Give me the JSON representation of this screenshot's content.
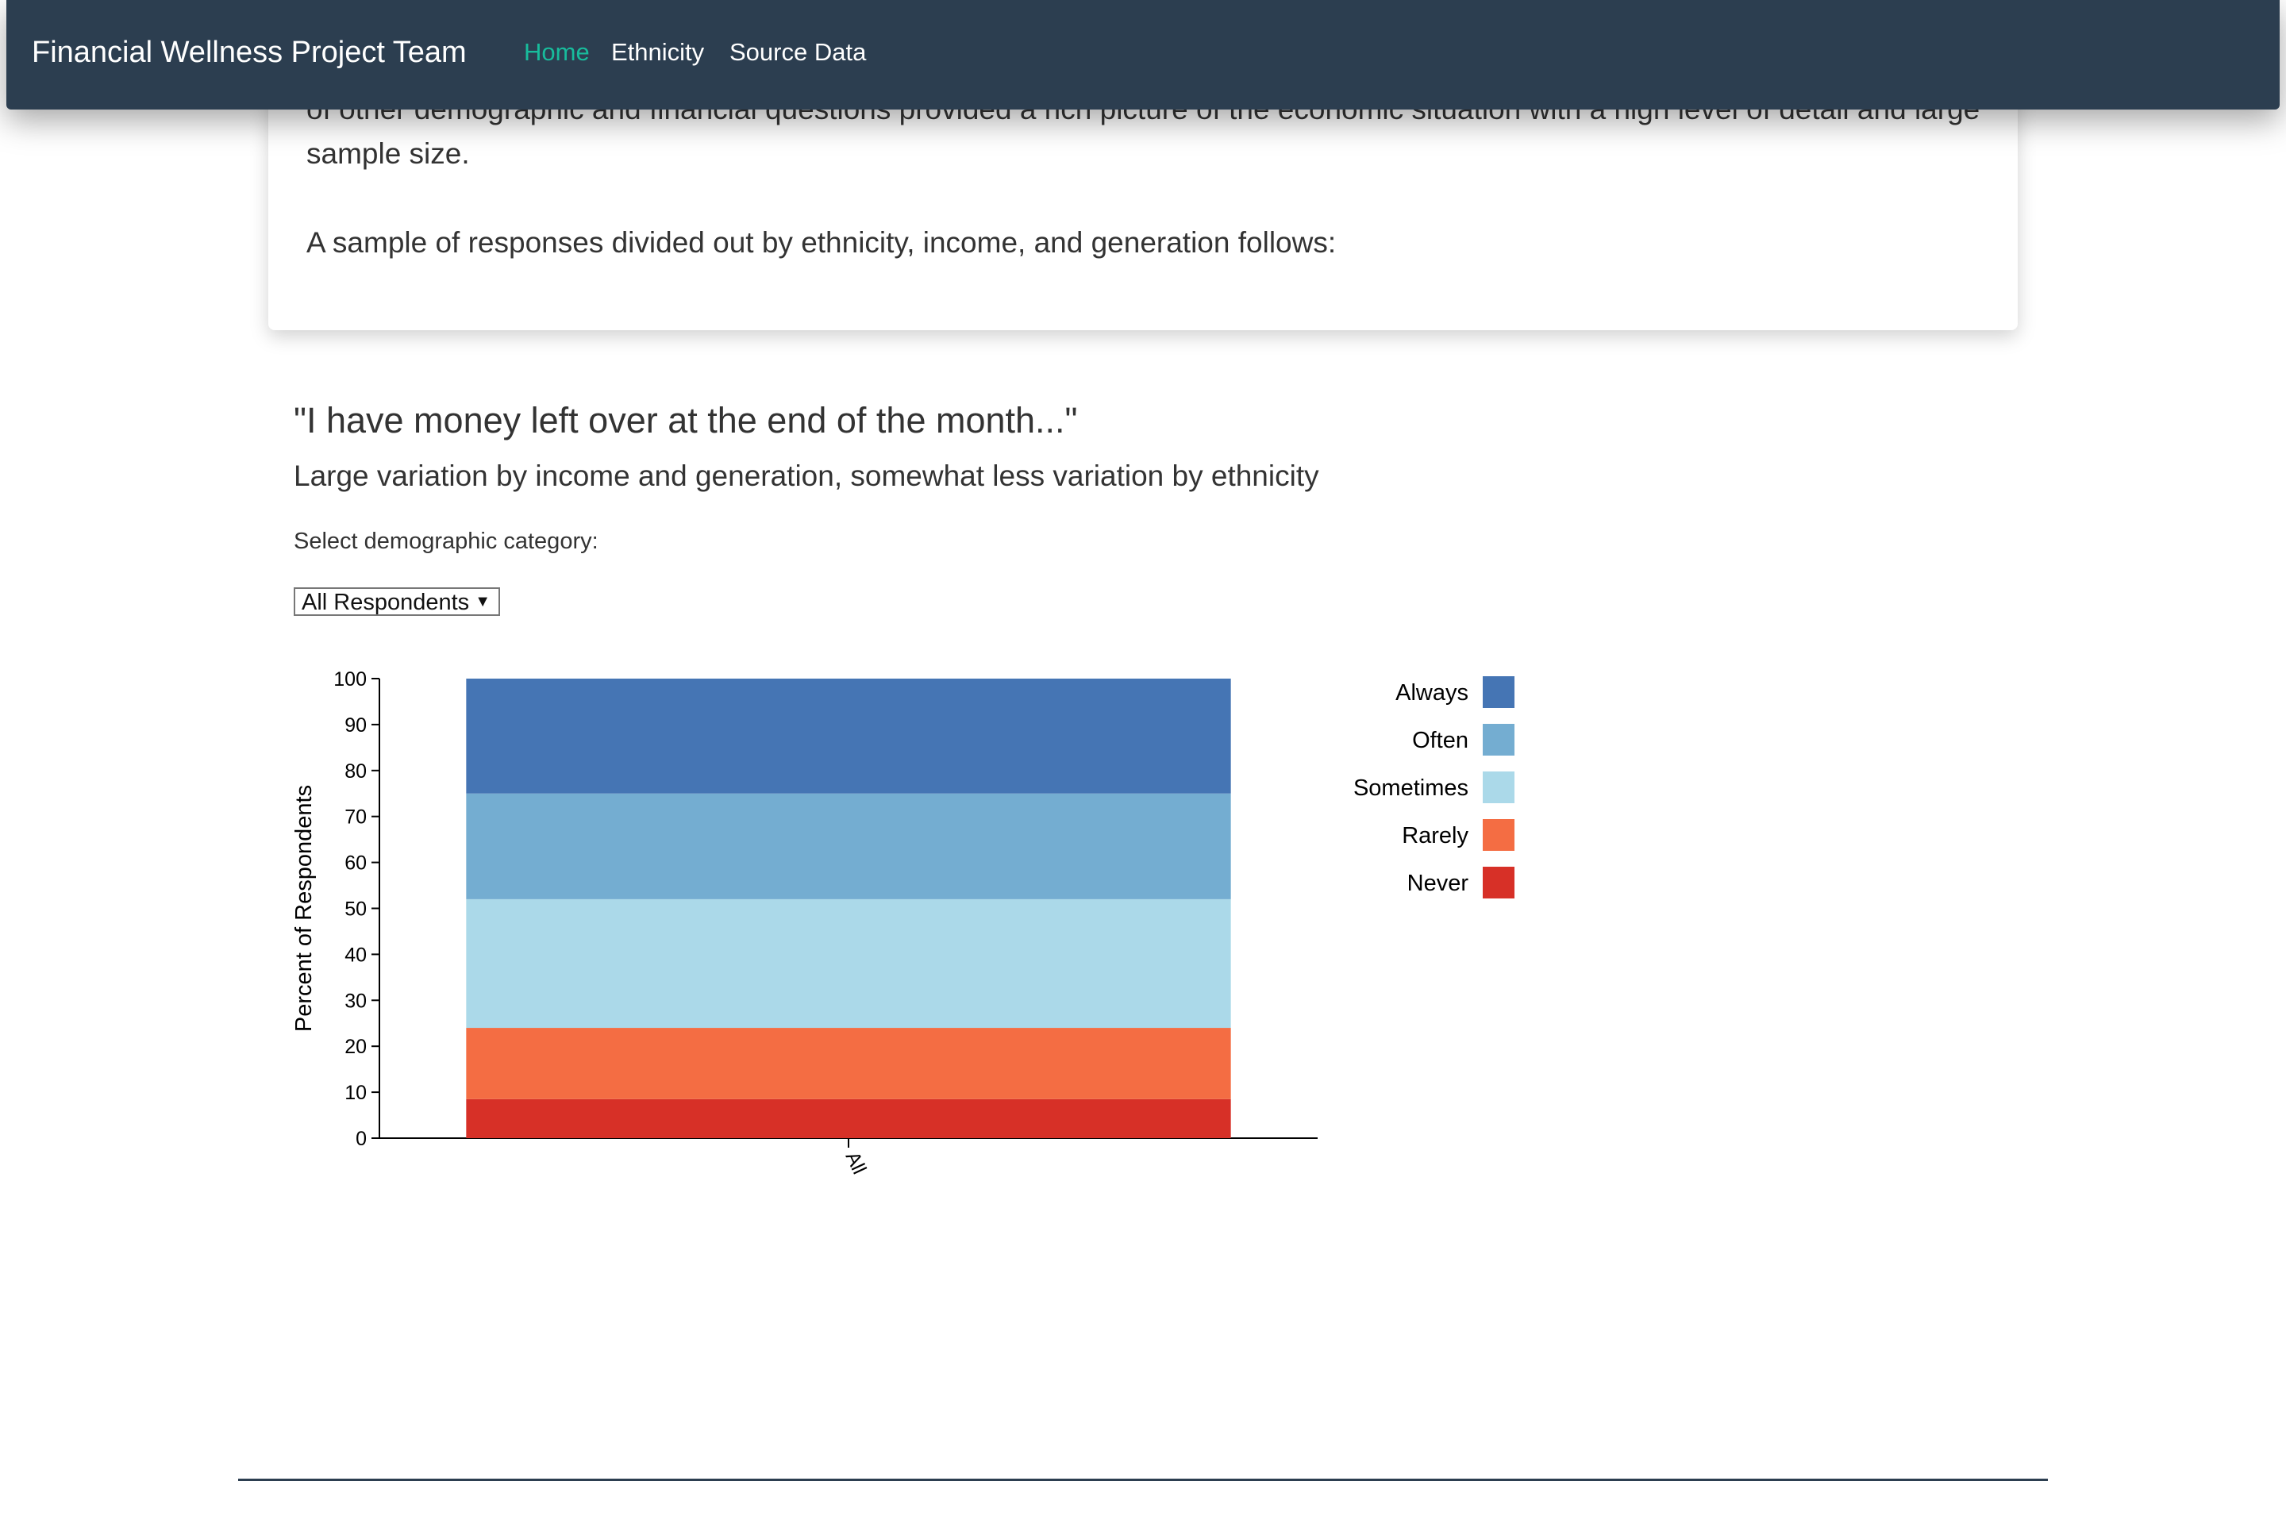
{
  "navbar": {
    "brand": "Financial Wellness Project Team",
    "links": [
      {
        "label": "Home",
        "active": true
      },
      {
        "label": "Ethnicity",
        "active": false
      },
      {
        "label": "Source Data",
        "active": false
      }
    ]
  },
  "intro": {
    "partial_paragraph": "of other demographic and financial questions provided a rich picture of the economic situation with a high level of detail and large sample size.",
    "sample_text": "A sample of responses divided out by ethnicity, income, and generation follows:"
  },
  "section": {
    "title": "\"I have money left over at the end of the month...\"",
    "subtitle": "Large variation by income and generation, somewhat less variation by ethnicity",
    "select_label": "Select demographic category:",
    "select_value": "All Respondents",
    "select_arrow": "▼"
  },
  "chart_data": {
    "type": "bar",
    "stacked": true,
    "categories": [
      "All"
    ],
    "series": [
      {
        "name": "Never",
        "values": [
          8.5
        ],
        "color": "#d73027"
      },
      {
        "name": "Rarely",
        "values": [
          15.5
        ],
        "color": "#f46d43"
      },
      {
        "name": "Sometimes",
        "values": [
          28
        ],
        "color": "#abd9e9"
      },
      {
        "name": "Often",
        "values": [
          23
        ],
        "color": "#74add1"
      },
      {
        "name": "Always",
        "values": [
          25
        ],
        "color": "#4575b4"
      }
    ],
    "legend_order": [
      "Always",
      "Often",
      "Sometimes",
      "Rarely",
      "Never"
    ],
    "ylabel": "Percent of Respondents",
    "xlabel": "",
    "ylim": [
      0,
      100
    ],
    "yticks": [
      0,
      10,
      20,
      30,
      40,
      50,
      60,
      70,
      80,
      90,
      100
    ],
    "legend_position": "right",
    "grid": false
  },
  "colors": {
    "navbar": "#2c3e50",
    "nav_active": "#18bc9c"
  }
}
